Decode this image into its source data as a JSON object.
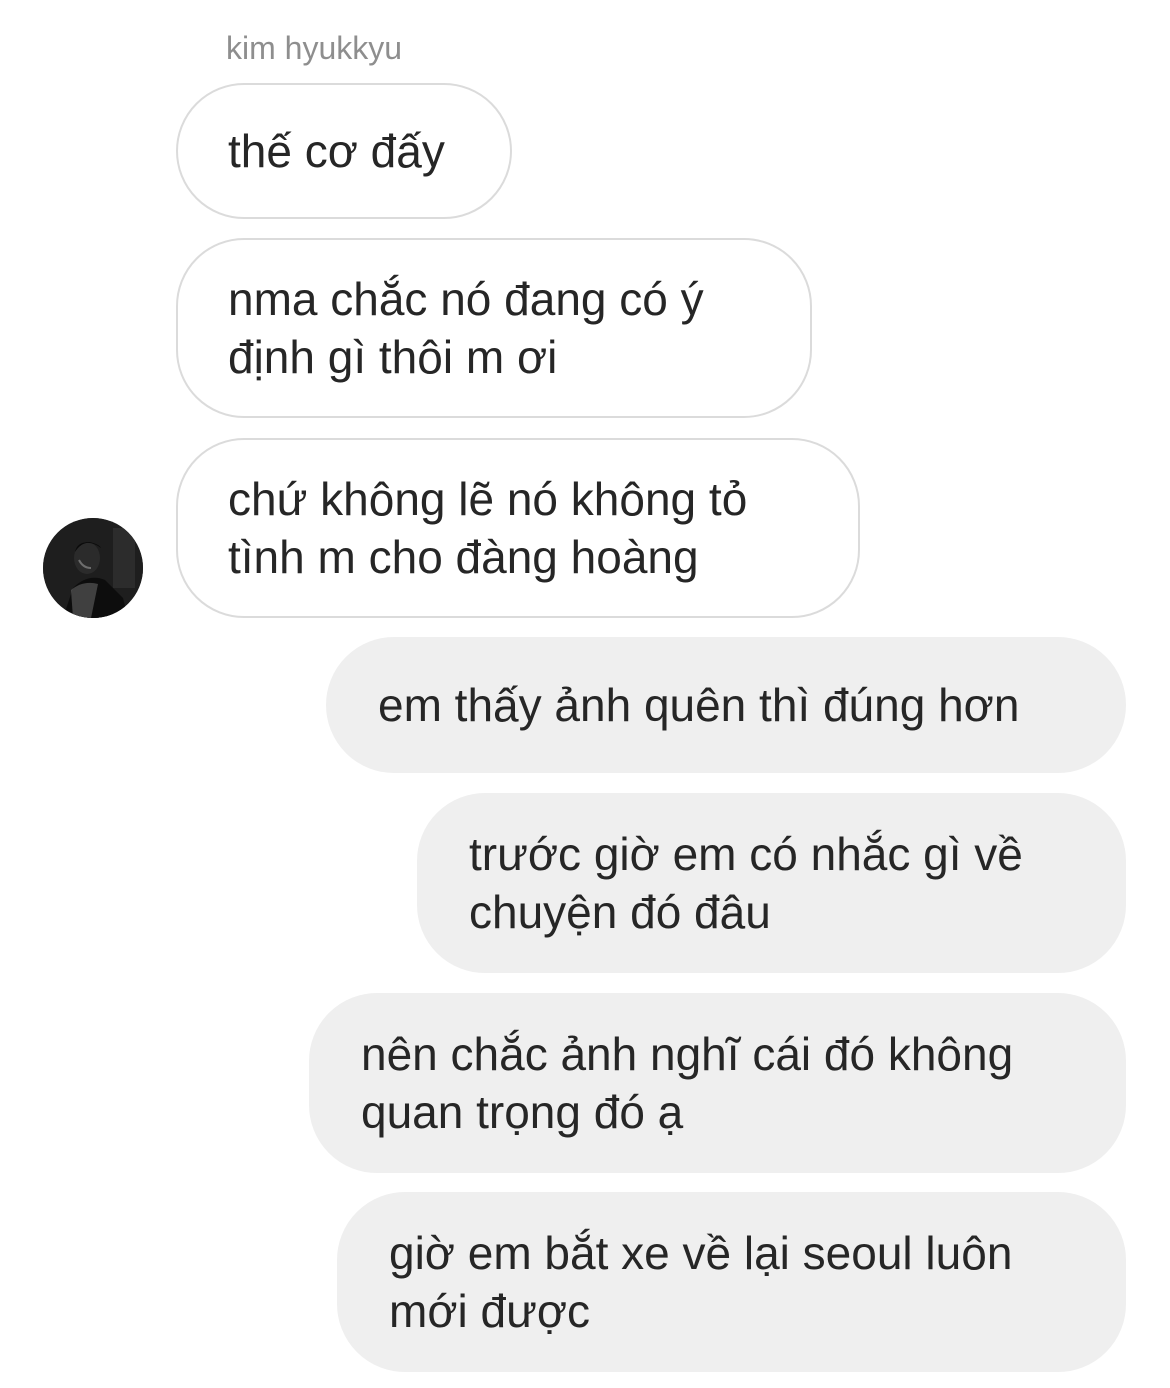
{
  "conversation": {
    "sender_name": "kim hyukkyu",
    "avatar_icon": "profile-photo-icon",
    "messages": [
      {
        "from": "other",
        "text": "thế cơ đấy"
      },
      {
        "from": "other",
        "text": "nma chắc nó đang có ý\nđịnh gì thôi m ơi"
      },
      {
        "from": "other",
        "text": "chứ không lẽ nó không tỏ\ntình m cho đàng hoàng"
      },
      {
        "from": "me",
        "text": "em thấy ảnh quên thì đúng hơn"
      },
      {
        "from": "me",
        "text": "trước giờ em có nhắc gì về\nchuyện đó đâu"
      },
      {
        "from": "me",
        "text": "nên chắc ảnh nghĩ cái đó không\nquan trọng đó ạ"
      },
      {
        "from": "me",
        "text": "giờ em bắt xe về lại seoul luôn\nmới được"
      }
    ]
  },
  "colors": {
    "received_bubble_bg": "#ffffff",
    "received_bubble_border": "#dbdbdb",
    "sent_bubble_bg": "#efefef",
    "text": "#262626",
    "sender_name": "#8e8e8e"
  }
}
